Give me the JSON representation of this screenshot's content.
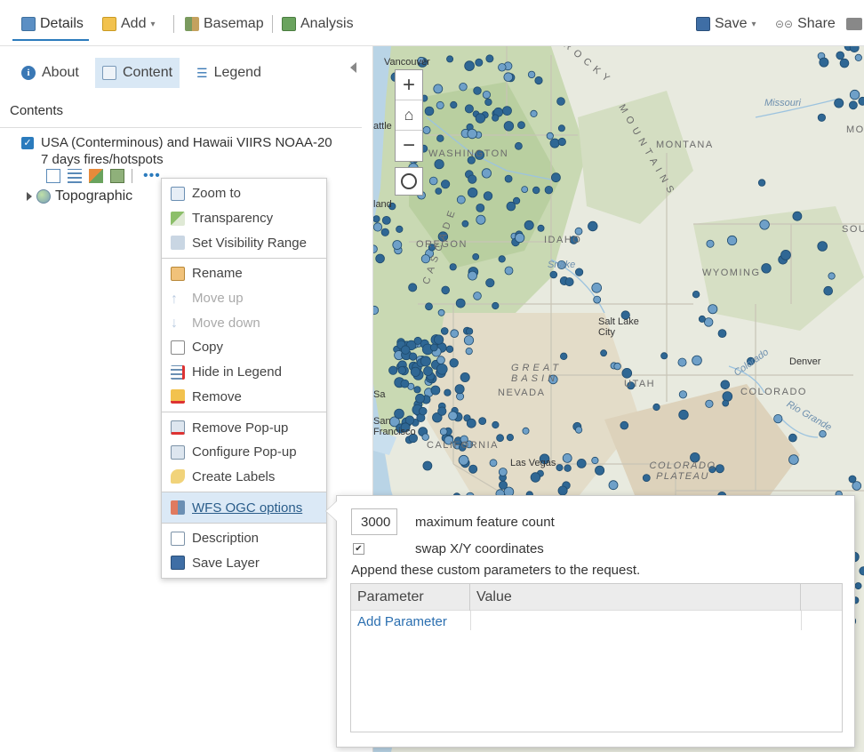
{
  "toolbar": {
    "details": "Details",
    "add": "Add",
    "basemap": "Basemap",
    "analysis": "Analysis",
    "save": "Save",
    "share": "Share"
  },
  "panel": {
    "tabs": {
      "about": "About",
      "content": "Content",
      "legend": "Legend"
    },
    "contents_heading": "Contents",
    "layer_title": "USA (Conterminous) and Hawaii VIIRS NOAA-20 7 days fires/hotspots",
    "basemap_layer": "Topographic"
  },
  "menu": {
    "zoom_to": "Zoom to",
    "transparency": "Transparency",
    "set_visibility_range": "Set Visibility Range",
    "rename": "Rename",
    "move_up": "Move up",
    "move_down": "Move down",
    "copy": "Copy",
    "hide_in_legend": "Hide in Legend",
    "remove": "Remove",
    "remove_popup": "Remove Pop-up",
    "configure_popup": "Configure Pop-up",
    "create_labels": "Create Labels",
    "wfs_ogc_options": "WFS OGC options",
    "description": "Description",
    "save_layer": "Save Layer"
  },
  "wfs": {
    "max_feature_count": "3000",
    "max_feature_label": "maximum feature count",
    "swap_checked": true,
    "swap_label": "swap X/Y coordinates",
    "append_label": "Append these custom parameters to the request.",
    "col_parameter": "Parameter",
    "col_value": "Value",
    "add_parameter": "Add Parameter"
  },
  "map": {
    "labels": {
      "montana": "MONTANA",
      "washington": "WASHINGTON",
      "oregon": "OREGON",
      "idaho": "IDAHO",
      "wyoming": "WYOMING",
      "nevada": "NEVADA",
      "utah": "UTAH",
      "colorado": "COLORADO",
      "great_basin": "GREAT BASIN",
      "colorado_plateau": "COLORADO PLATEAU",
      "rocky": "R O C K Y",
      "mountains": "M O U N T A I N S",
      "cascade": "C A S C A D E",
      "california": "CALIFORNIA",
      "sou": "SOU",
      "mo": "MO"
    },
    "cities": {
      "vancouver": "Vancouver",
      "seattle": "attle",
      "portland": "land",
      "salt_lake": "Salt Lake City",
      "denver": "Denver",
      "las_vegas": "Las Vegas",
      "sacramento": "Sa",
      "san_francisco": "San Francisco",
      "missouri": "Missouri",
      "snake": "Snake",
      "rio_grande": "Rio Grande",
      "colorado_river": "Colorado"
    },
    "colors": {
      "hotspot": "#2f6794",
      "hotspot_stroke": "#1e4a6d"
    }
  }
}
